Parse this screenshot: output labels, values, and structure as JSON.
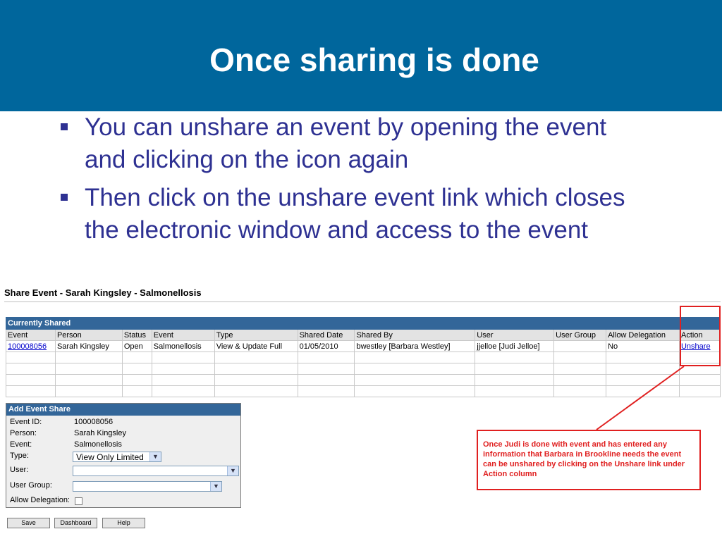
{
  "slide": {
    "title": "Once sharing is done",
    "bullets": [
      "You can unshare an event by opening the event and clicking on the icon again",
      "Then click on the unshare event link which closes the electronic window and access to the event"
    ]
  },
  "screen": {
    "title": "Share Event - Sarah Kingsley - Salmonellosis",
    "shared": {
      "caption": "Currently Shared",
      "headers": [
        "Event",
        "Person",
        "Status",
        "Event",
        "Type",
        "Shared Date",
        "Shared By",
        "User",
        "User Group",
        "Allow Delegation",
        "Action"
      ],
      "row": {
        "event_id": "100008056",
        "person": "Sarah Kingsley",
        "status": "Open",
        "event": "Salmonellosis",
        "type": "View & Update Full",
        "shared_date": "01/05/2010",
        "shared_by": "bwestley [Barbara Westley]",
        "user": "jjelloe [Judi Jelloe]",
        "user_group": "",
        "allow_delegation": "No",
        "action": "Unshare"
      }
    },
    "add": {
      "caption": "Add Event Share",
      "event_id_label": "Event ID:",
      "event_id_value": "100008056",
      "person_label": "Person:",
      "person_value": "Sarah Kingsley",
      "event_label": "Event:",
      "event_value": "Salmonellosis",
      "type_label": "Type:",
      "type_value": "View Only Limited",
      "user_label": "User:",
      "user_value": "",
      "user_group_label": "User Group:",
      "user_group_value": "",
      "delegation_label": "Allow Delegation:"
    },
    "buttons": {
      "save": "Save",
      "dashboard": "Dashboard",
      "help": "Help"
    }
  },
  "annotation": {
    "text": "Once Judi is done with event and has entered any information that Barbara in Brookline needs the event can be unshared by clicking on the Unshare link under Action column",
    "color": "#e02020"
  },
  "colors": {
    "header_bg": "#00669c",
    "bullet_text": "#2e3192",
    "table_caption": "#336699"
  }
}
